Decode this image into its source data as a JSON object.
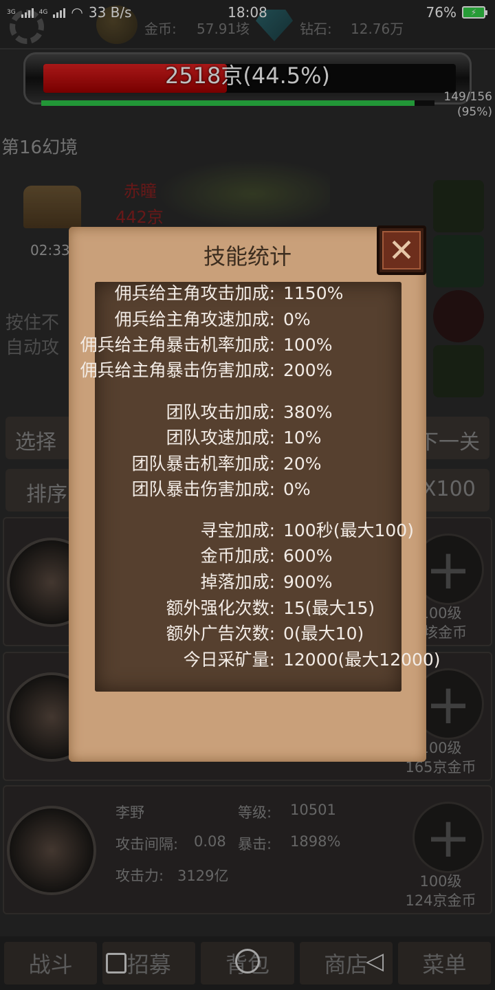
{
  "status_bar": {
    "network_left": "3G",
    "network_right": "4G",
    "speed": "33 B/s",
    "time": "18:08",
    "battery": "76%"
  },
  "currency": {
    "gold_label": "金币:",
    "gold_value": "57.91垓",
    "diamond_label": "钻石:",
    "diamond_value": "12.76万"
  },
  "boss_bar": {
    "hp_text": "2518京(44.5%)",
    "hp_fraction": 0.445,
    "progress_text_line1": "149/156",
    "progress_text_line2": "(95%)",
    "progress_fraction": 0.95
  },
  "stage": {
    "title": "第16幻境",
    "chest_timer": "02:33",
    "boss_name": "赤瞳",
    "boss_hp": "442京",
    "hint_line1": "按住不",
    "hint_line2": "自动攻"
  },
  "controls": {
    "select_label": "选择",
    "next_label": "下一关",
    "sort_label": "排序",
    "multiplier_label": "X100"
  },
  "heroes": [
    {
      "level": "100级",
      "cost": "9垓金币"
    },
    {
      "level": "100级",
      "cost": "165京金币"
    },
    {
      "name": "李野",
      "level_label": "等级:",
      "level_value": "10501",
      "interval_label": "攻击间隔:",
      "interval_value": "0.08",
      "crit_label": "暴击:",
      "crit_value": "1898%",
      "attack_label": "攻击力:",
      "attack_value": "3129亿",
      "upgrade_level": "100级",
      "upgrade_cost": "124京金币"
    }
  ],
  "bottom_nav": {
    "battle": "战斗",
    "recruit": "招募",
    "bag": "背包",
    "shop": "商店",
    "menu": "菜单"
  },
  "dialog": {
    "title": "技能统计",
    "close": "✕",
    "stats": [
      {
        "label": "佣兵给主角攻击加成:",
        "value": "1150%"
      },
      {
        "label": "佣兵给主角攻速加成:",
        "value": "0%"
      },
      {
        "label": "佣兵给主角暴击机率加成:",
        "value": "100%"
      },
      {
        "label": "佣兵给主角暴击伤害加成:",
        "value": "200%"
      },
      {
        "label": "团队攻击加成:",
        "value": "380%"
      },
      {
        "label": "团队攻速加成:",
        "value": "10%"
      },
      {
        "label": "团队暴击机率加成:",
        "value": "20%"
      },
      {
        "label": "团队暴击伤害加成:",
        "value": "0%"
      },
      {
        "label": "寻宝加成:",
        "value": "100秒(最大100)"
      },
      {
        "label": "金币加成:",
        "value": "600%"
      },
      {
        "label": "掉落加成:",
        "value": "900%"
      },
      {
        "label": "额外强化次数:",
        "value": "15(最大15)"
      },
      {
        "label": "额外广告次数:",
        "value": "0(最大10)"
      },
      {
        "label": "今日采矿量:",
        "value": "12000(最大12000)"
      }
    ]
  }
}
